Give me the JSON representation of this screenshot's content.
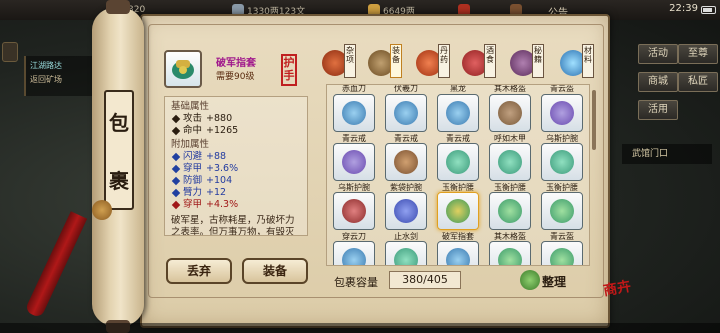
{
  "topbar": {
    "stamina": "/320",
    "silver": "1330两123文",
    "gold": "6649两",
    "notice": "公告",
    "time": "22:39"
  },
  "quest": {
    "line1": "江湖路达",
    "line2": "返回矿场"
  },
  "right_menu": {
    "activity": "活动",
    "vip": "至尊",
    "shop": "商城",
    "private": "私匠",
    "marketplace": "活用",
    "wuguan": "武馆门口"
  },
  "scroll_title": [
    "包",
    "裹"
  ],
  "item": {
    "name": "破军指套",
    "level_req": "需要90级",
    "slot": "护手"
  },
  "base_attrs_header": "基础属性",
  "base_attrs": [
    {
      "label": "攻击",
      "value": "+880"
    },
    {
      "label": "命中",
      "value": "+1265"
    }
  ],
  "extra_attrs_header": "附加属性",
  "extra_attrs": [
    {
      "label": "闪避",
      "value": "+88",
      "color": "blue"
    },
    {
      "label": "穿甲",
      "value": "+3.6%",
      "color": "blue"
    },
    {
      "label": "防御",
      "value": "+104",
      "color": "blue"
    },
    {
      "label": "臂力",
      "value": "+12",
      "color": "blue"
    },
    {
      "label": "穿甲",
      "value": "+4.3%",
      "color": "red"
    }
  ],
  "description": "破军星，古称耗星，乃破坏力之表率。但万事万物，有毁灭便有重生。破军指套便如此。",
  "buttons": {
    "discard": "丢弃",
    "equip": "装备",
    "sort": "整理"
  },
  "categories": [
    {
      "label": "杂项",
      "color": "#b24a20"
    },
    {
      "label": "装备",
      "color": "#8a6a3a"
    },
    {
      "label": "丹药",
      "color": "#c05020"
    },
    {
      "label": "酒食",
      "color": "#c04040"
    },
    {
      "label": "秘籍",
      "color": "#7a4a70"
    },
    {
      "label": "材料",
      "color": "#4aa0d0"
    }
  ],
  "grid": {
    "top_row_names": [
      "赤血刀",
      "伏羲刀",
      "黑龙",
      "其木格盔",
      "青云盔"
    ],
    "rows": [
      {
        "names": [
          "青云戒",
          "青云戒",
          "青云戒",
          "呼如木甲",
          "乌斯护腕"
        ],
        "colors": [
          "#3a7ab0",
          "#3a7ab0",
          "#3a7ab0",
          "#7a5a3a",
          "#6a4ab0"
        ]
      },
      {
        "names": [
          "乌斯护腕",
          "紫袋护腕",
          "玉衡护腰",
          "玉衡护腰",
          "玉衡护腰"
        ],
        "colors": [
          "#6a4ab0",
          "#7a5030",
          "#3a9a7a",
          "#3a9a7a",
          "#3a9a7a"
        ]
      },
      {
        "names": [
          "穿云刀",
          "止水剑",
          "破军指套",
          "其木格盔",
          "青云盔"
        ],
        "colors": [
          "#8a2a2a",
          "#3a4ab0",
          "#3a9a5a",
          "#3a9a6a",
          "#3a9a6a"
        ]
      },
      {
        "names": [
          "",
          "",
          "",
          "",
          ""
        ],
        "colors": [
          "#3a7ab0",
          "#3a9a7a",
          "#3a7ab0",
          "#3a9a6a",
          "#3a9a6a"
        ]
      }
    ]
  },
  "capacity": {
    "label": "包裹容量",
    "value": "380/405"
  },
  "stamp": "商卉"
}
